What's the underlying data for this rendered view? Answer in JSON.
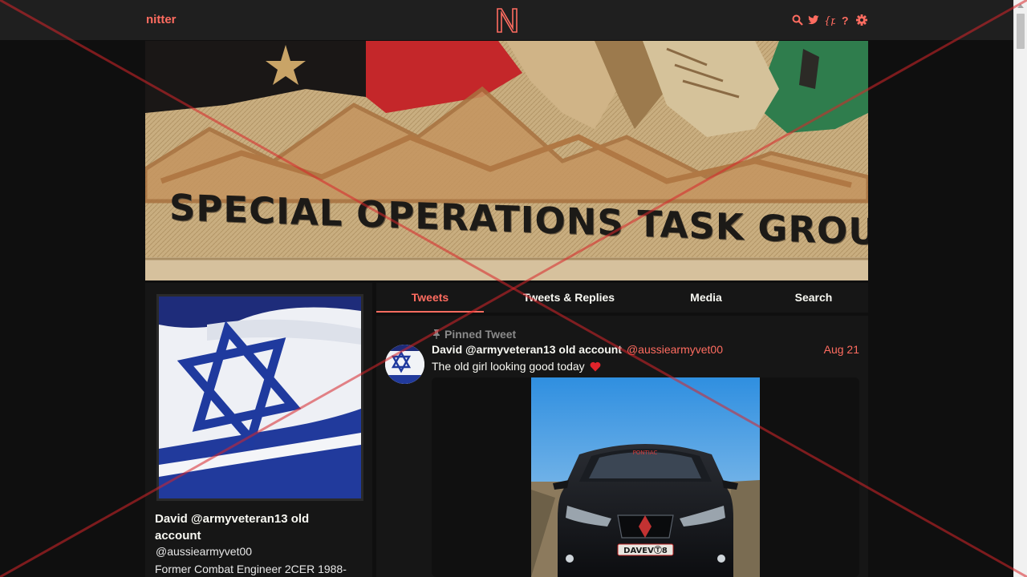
{
  "nav": {
    "brand": "nitter",
    "icons": [
      "search-icon",
      "twitter-icon",
      "rss-icon",
      "help-icon",
      "gear-icon"
    ]
  },
  "banner": {
    "text": "SPECIAL OPERATIONS TASK GROUP"
  },
  "profile": {
    "fullname": "David @armyveteran13 old account",
    "username": "@aussiearmyvet00",
    "bio": "Former Combat Engineer 2CER 1988-"
  },
  "tabs": [
    {
      "label": "Tweets",
      "active": true
    },
    {
      "label": "Tweets & Replies",
      "active": false
    },
    {
      "label": "Media",
      "active": false
    },
    {
      "label": "Search",
      "active": false
    }
  ],
  "tweet": {
    "pinned_label": "Pinned Tweet",
    "fullname": "David @armyveteran13 old account",
    "username": "@aussiearmyvet00",
    "date": "Aug 21",
    "text": "The old girl looking good today",
    "plate": "DAVEVⓉ8",
    "windshield_banner": "PONTIAC"
  },
  "colors": {
    "accent": "#ff6c60",
    "background": "#0f0f0f",
    "panel": "#161616",
    "navbar": "#1f1f1f"
  }
}
